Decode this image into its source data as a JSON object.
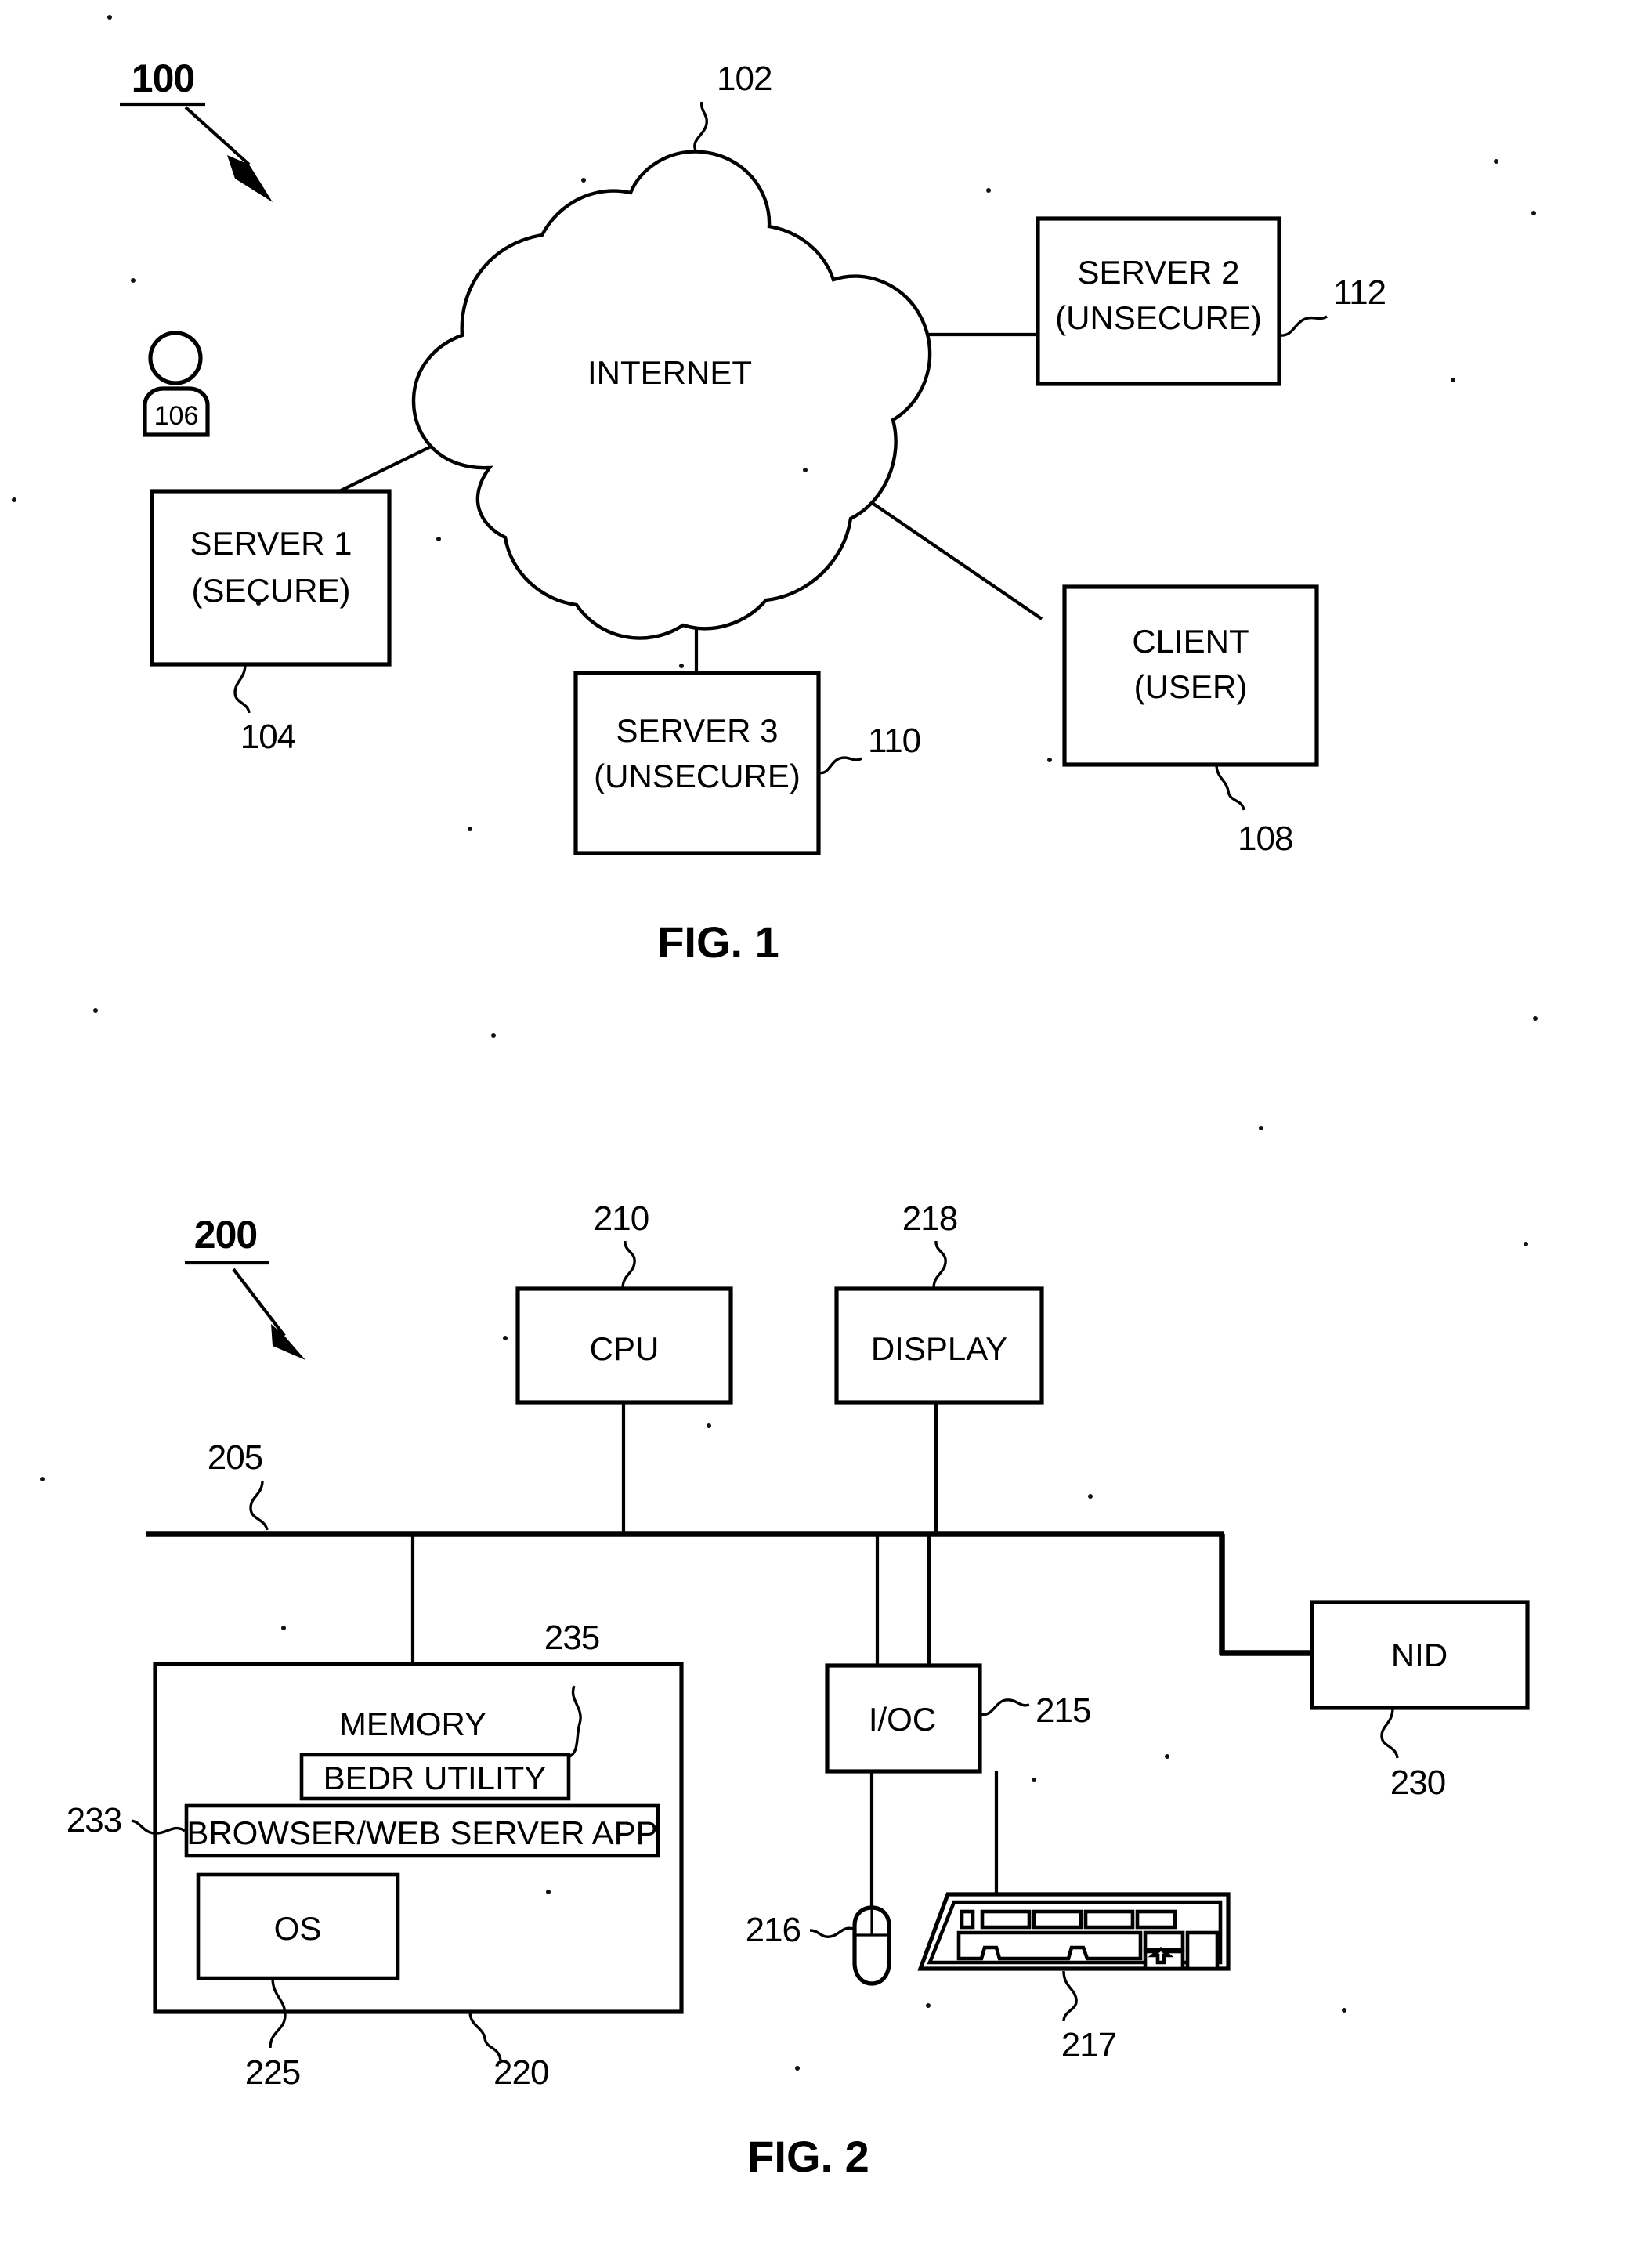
{
  "document": {
    "type": "patent-drawing-sheet",
    "figures": [
      {
        "caption": "FIG. 1",
        "figure_ref": "100",
        "nodes": [
          {
            "ref": "102",
            "label_line1": "INTERNET",
            "label_line2": "",
            "shape": "cloud"
          },
          {
            "ref": "112",
            "label_line1": "SERVER 2",
            "label_line2": "(UNSECURE)",
            "shape": "rect"
          },
          {
            "ref": "104",
            "label_line1": "SERVER 1",
            "label_line2": "(SECURE)",
            "shape": "rect"
          },
          {
            "ref": "110",
            "label_line1": "SERVER 3",
            "label_line2": "(UNSECURE)",
            "shape": "rect"
          },
          {
            "ref": "108",
            "label_line1": "CLIENT",
            "label_line2": "(USER)",
            "shape": "rect"
          },
          {
            "ref": "106",
            "label_line1": "106",
            "label_line2": "",
            "shape": "person"
          }
        ]
      },
      {
        "caption": "FIG. 2",
        "figure_ref": "200",
        "nodes": [
          {
            "ref": "210",
            "label_line1": "CPU",
            "label_line2": "",
            "shape": "rect"
          },
          {
            "ref": "218",
            "label_line1": "DISPLAY",
            "label_line2": "",
            "shape": "rect"
          },
          {
            "ref": "205",
            "label_line1": "",
            "label_line2": "",
            "shape": "bus"
          },
          {
            "ref": "220",
            "label_line1": "MEMORY",
            "label_line2": "",
            "shape": "rect"
          },
          {
            "ref": "235",
            "label_line1": "BEDR UTILITY",
            "label_line2": "",
            "shape": "rect"
          },
          {
            "ref": "233",
            "label_line1": "BROWSER/WEB SERVER APP",
            "label_line2": "",
            "shape": "rect"
          },
          {
            "ref": "225",
            "label_line1": "OS",
            "label_line2": "",
            "shape": "rect"
          },
          {
            "ref": "215",
            "label_line1": "I/OC",
            "label_line2": "",
            "shape": "rect"
          },
          {
            "ref": "230",
            "label_line1": "NID",
            "label_line2": "",
            "shape": "rect"
          },
          {
            "ref": "216",
            "label_line1": "",
            "label_line2": "",
            "shape": "mouse"
          },
          {
            "ref": "217",
            "label_line1": "",
            "label_line2": "",
            "shape": "keyboard"
          }
        ]
      }
    ]
  },
  "fig1": {
    "figure_ref": "100",
    "caption": "FIG. 1",
    "cloud": {
      "label": "INTERNET",
      "ref": "102"
    },
    "server2": {
      "line1": "SERVER 2",
      "line2": "(UNSECURE)",
      "ref": "112"
    },
    "server1": {
      "line1": "SERVER 1",
      "line2": "(SECURE)",
      "ref": "104"
    },
    "server3": {
      "line1": "SERVER 3",
      "line2": "(UNSECURE)",
      "ref": "110"
    },
    "client": {
      "line1": "CLIENT",
      "line2": "(USER)",
      "ref": "108"
    },
    "person": {
      "ref": "106"
    }
  },
  "fig2": {
    "figure_ref": "200",
    "caption": "FIG. 2",
    "cpu": {
      "label": "CPU",
      "ref": "210"
    },
    "display": {
      "label": "DISPLAY",
      "ref": "218"
    },
    "bus": {
      "ref": "205"
    },
    "memory": {
      "label": "MEMORY",
      "ref": "220"
    },
    "bedr": {
      "label": "BEDR UTILITY",
      "ref": "235"
    },
    "browser": {
      "label": "BROWSER/WEB SERVER APP",
      "ref": "233"
    },
    "os": {
      "label": "OS",
      "ref": "225"
    },
    "ioc": {
      "label": "I/OC",
      "ref": "215"
    },
    "nid": {
      "label": "NID",
      "ref": "230"
    },
    "mouse": {
      "ref": "216"
    },
    "keyboard": {
      "ref": "217"
    }
  },
  "colors": {
    "ink": "#000000",
    "paper": "#ffffff"
  }
}
